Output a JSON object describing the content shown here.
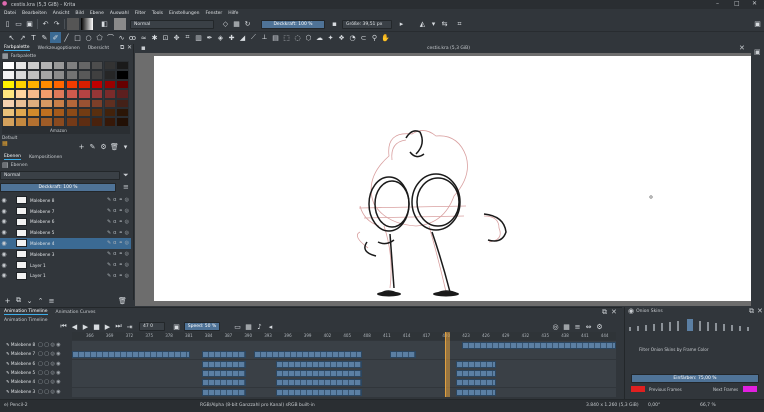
{
  "titlebar": {
    "title": "cestis.kra (5,3 GiB) - Krita",
    "controls": [
      "–",
      "□",
      "✕"
    ]
  },
  "menu": [
    "Datei",
    "Bearbeiten",
    "Ansicht",
    "Bild",
    "Ebene",
    "Auswahl",
    "Filter",
    "Tools",
    "Einstellungen",
    "Fenster",
    "Hilfe"
  ],
  "toolbar": {
    "blend_mode": "Normal",
    "opacity_label": "Deckkraft: 100 %",
    "size_label": "Größe: 39,51 px"
  },
  "left_dock": {
    "palette_tabs": [
      "Farbpalette",
      "Werkzeugoptionen",
      "Übersicht"
    ],
    "palette_name": "Amazon",
    "palette_default": "Default",
    "swatch_colors": [
      [
        "#ffffff",
        "#e6e6e6",
        "#cccccc",
        "#b3b3b3",
        "#999999",
        "#808080",
        "#666666",
        "#4d4d4d",
        "#333333",
        "#1a1a1a"
      ],
      [
        "#f2f2f2",
        "#d9d9d9",
        "#bfbfbf",
        "#a6a6a6",
        "#8c8c8c",
        "#737373",
        "#595959",
        "#404040",
        "#262626",
        "#000000"
      ],
      [
        "#fff200",
        "#ffd200",
        "#ffb000",
        "#ff8c00",
        "#ff6600",
        "#f23c00",
        "#d91e00",
        "#c00000",
        "#990000",
        "#660000"
      ],
      [
        "#ffe680",
        "#ffd4a0",
        "#f7b98a",
        "#f39c6b",
        "#e0795a",
        "#cf5a4d",
        "#b54343",
        "#963636",
        "#7a2b2b",
        "#5c1f1f"
      ],
      [
        "#f4d1b0",
        "#eac096",
        "#deae7e",
        "#d89a63",
        "#c97f49",
        "#b5673a",
        "#9a5233",
        "#7d3f29",
        "#5f2f20",
        "#432118"
      ],
      [
        "#e9c17a",
        "#e0a84f",
        "#d08a2c",
        "#c07020",
        "#a55a1b",
        "#8c4a17",
        "#733c13",
        "#5a2f0f",
        "#42220b",
        "#2b1607"
      ],
      [
        "#d4a15c",
        "#c4883f",
        "#b37030",
        "#9f5c27",
        "#8a4a1f",
        "#743a18",
        "#5e2d12",
        "#4a220d",
        "#361808",
        "#221005"
      ]
    ],
    "layer_tabs": [
      "Ebenen",
      "Kompositionen"
    ],
    "layers_header": "Ebenen",
    "layers_mode": "Normal",
    "layers_opacity": "Deckkraft: 100 %",
    "layers": [
      {
        "name": "Malebene 8",
        "selected": false
      },
      {
        "name": "Malebene 7",
        "selected": false
      },
      {
        "name": "Malebene 6",
        "selected": false
      },
      {
        "name": "Malebene 5",
        "selected": false
      },
      {
        "name": "Malebene 4",
        "selected": true
      },
      {
        "name": "Malebene 3",
        "selected": false
      },
      {
        "name": "Layer 1",
        "selected": false
      },
      {
        "name": "Layer 1",
        "selected": false
      }
    ]
  },
  "canvas": {
    "document_title": "cestis.kra (5,3 GiB)"
  },
  "timeline": {
    "tabs": [
      "Animation Timeline",
      "Animation Curves"
    ],
    "header": "Animation Timeline",
    "start_field": "47 0",
    "speed_label": "Speed: 50 %",
    "ruler": [
      "366",
      "369",
      "372",
      "375",
      "378",
      "381",
      "384",
      "387",
      "390",
      "393",
      "396",
      "399",
      "402",
      "405",
      "408",
      "411",
      "414",
      "417",
      "420",
      "423",
      "426",
      "429",
      "432",
      "435",
      "438",
      "441",
      "444"
    ],
    "rows": [
      {
        "name": "Malebene 8",
        "blocks": [
          [
            462,
            616
          ]
        ]
      },
      {
        "name": "Malebene 7",
        "blocks": [
          [
            72,
            190
          ],
          [
            202,
            246
          ],
          [
            254,
            362
          ],
          [
            390,
            416
          ]
        ]
      },
      {
        "name": "Malebene 6",
        "blocks": [
          [
            202,
            246
          ],
          [
            276,
            362
          ],
          [
            456,
            496
          ]
        ]
      },
      {
        "name": "Malebene 5",
        "blocks": [
          [
            202,
            246
          ],
          [
            276,
            362
          ],
          [
            456,
            496
          ]
        ]
      },
      {
        "name": "Malebene 4",
        "blocks": [
          [
            202,
            246
          ],
          [
            276,
            362
          ],
          [
            456,
            496
          ]
        ]
      },
      {
        "name": "Malebene 3",
        "blocks": [
          [
            202,
            246
          ],
          [
            276,
            362
          ],
          [
            456,
            496
          ]
        ]
      }
    ]
  },
  "onion": {
    "title": "Onion Skins",
    "filter_label": "Filter Onion Skins by Frame Color",
    "tint_label": "Einfärben: 75,00 %",
    "previous_label": "Previous Frames",
    "next_label": "Next Frames",
    "previous_color": "#e02020",
    "next_color": "#e020e0"
  },
  "status": {
    "brush": "e) Pencil-2",
    "color_info": "RGB/Alpha (8-bit Ganzzahl pro Kanal) sRGB built-in",
    "dims": "3.840 x 1.260 (5,3 GiB)",
    "rotation": "0,00°",
    "zoom": "66,7 %"
  },
  "colors": {
    "accent": "#3daee9",
    "selection": "#3b6a93",
    "frame_block": "#5b7fa3"
  }
}
